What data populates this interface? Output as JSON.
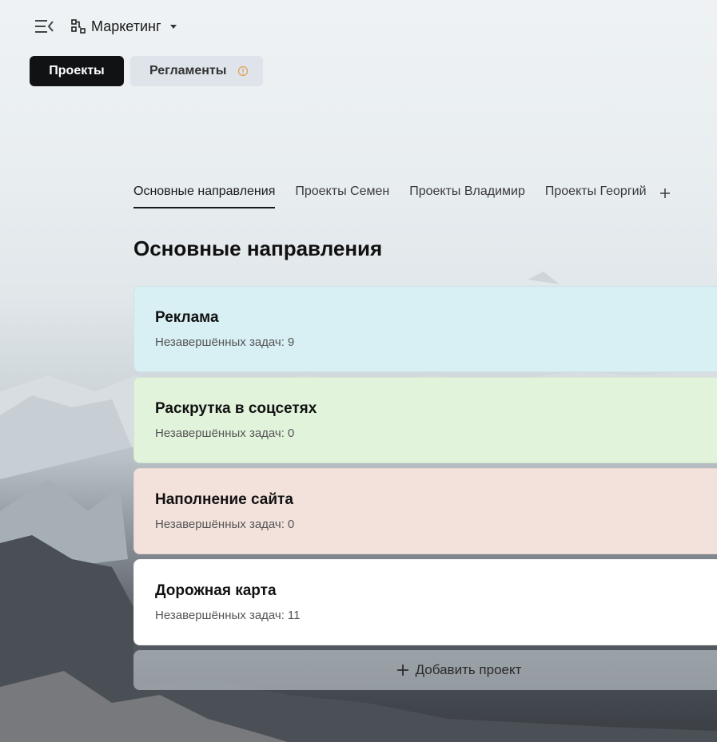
{
  "header": {
    "workspace_name": "Маркетинг"
  },
  "top_tabs": [
    {
      "label": "Проекты",
      "active": true
    },
    {
      "label": "Регламенты",
      "active": false,
      "has_warning": true
    }
  ],
  "sub_tabs": [
    {
      "label": "Основные направления",
      "active": true
    },
    {
      "label": "Проекты Семен",
      "active": false
    },
    {
      "label": "Проекты Владимир",
      "active": false
    },
    {
      "label": "Проекты Георгий",
      "active": false
    }
  ],
  "section": {
    "title": "Основные направления"
  },
  "projects": [
    {
      "name": "Реклама",
      "count_label": "Незавершённых задач:",
      "count": "9",
      "color": "#d8eff4"
    },
    {
      "name": "Раскрутка в соцсетях",
      "count_label": "Незавершённых задач:",
      "count": "0",
      "color": "#e2f3dc"
    },
    {
      "name": "Наполнение сайта",
      "count_label": "Незавершённых задач:",
      "count": "0",
      "color": "#f3e2dc"
    },
    {
      "name": "Дорожная карта",
      "count_label": "Незавершённых задач:",
      "count": "11",
      "color": "#ffffff"
    }
  ],
  "add_project_label": "Добавить проект",
  "colors": {
    "active_tab_bg": "#111214",
    "warning": "#e0a050"
  },
  "icons": {
    "menu": "menu-collapse-icon",
    "workspace": "workspace-icon",
    "caret": "caret-down-icon",
    "warning": "warning-circle-icon",
    "add_tab": "plus-icon",
    "add_project": "plus-icon"
  }
}
